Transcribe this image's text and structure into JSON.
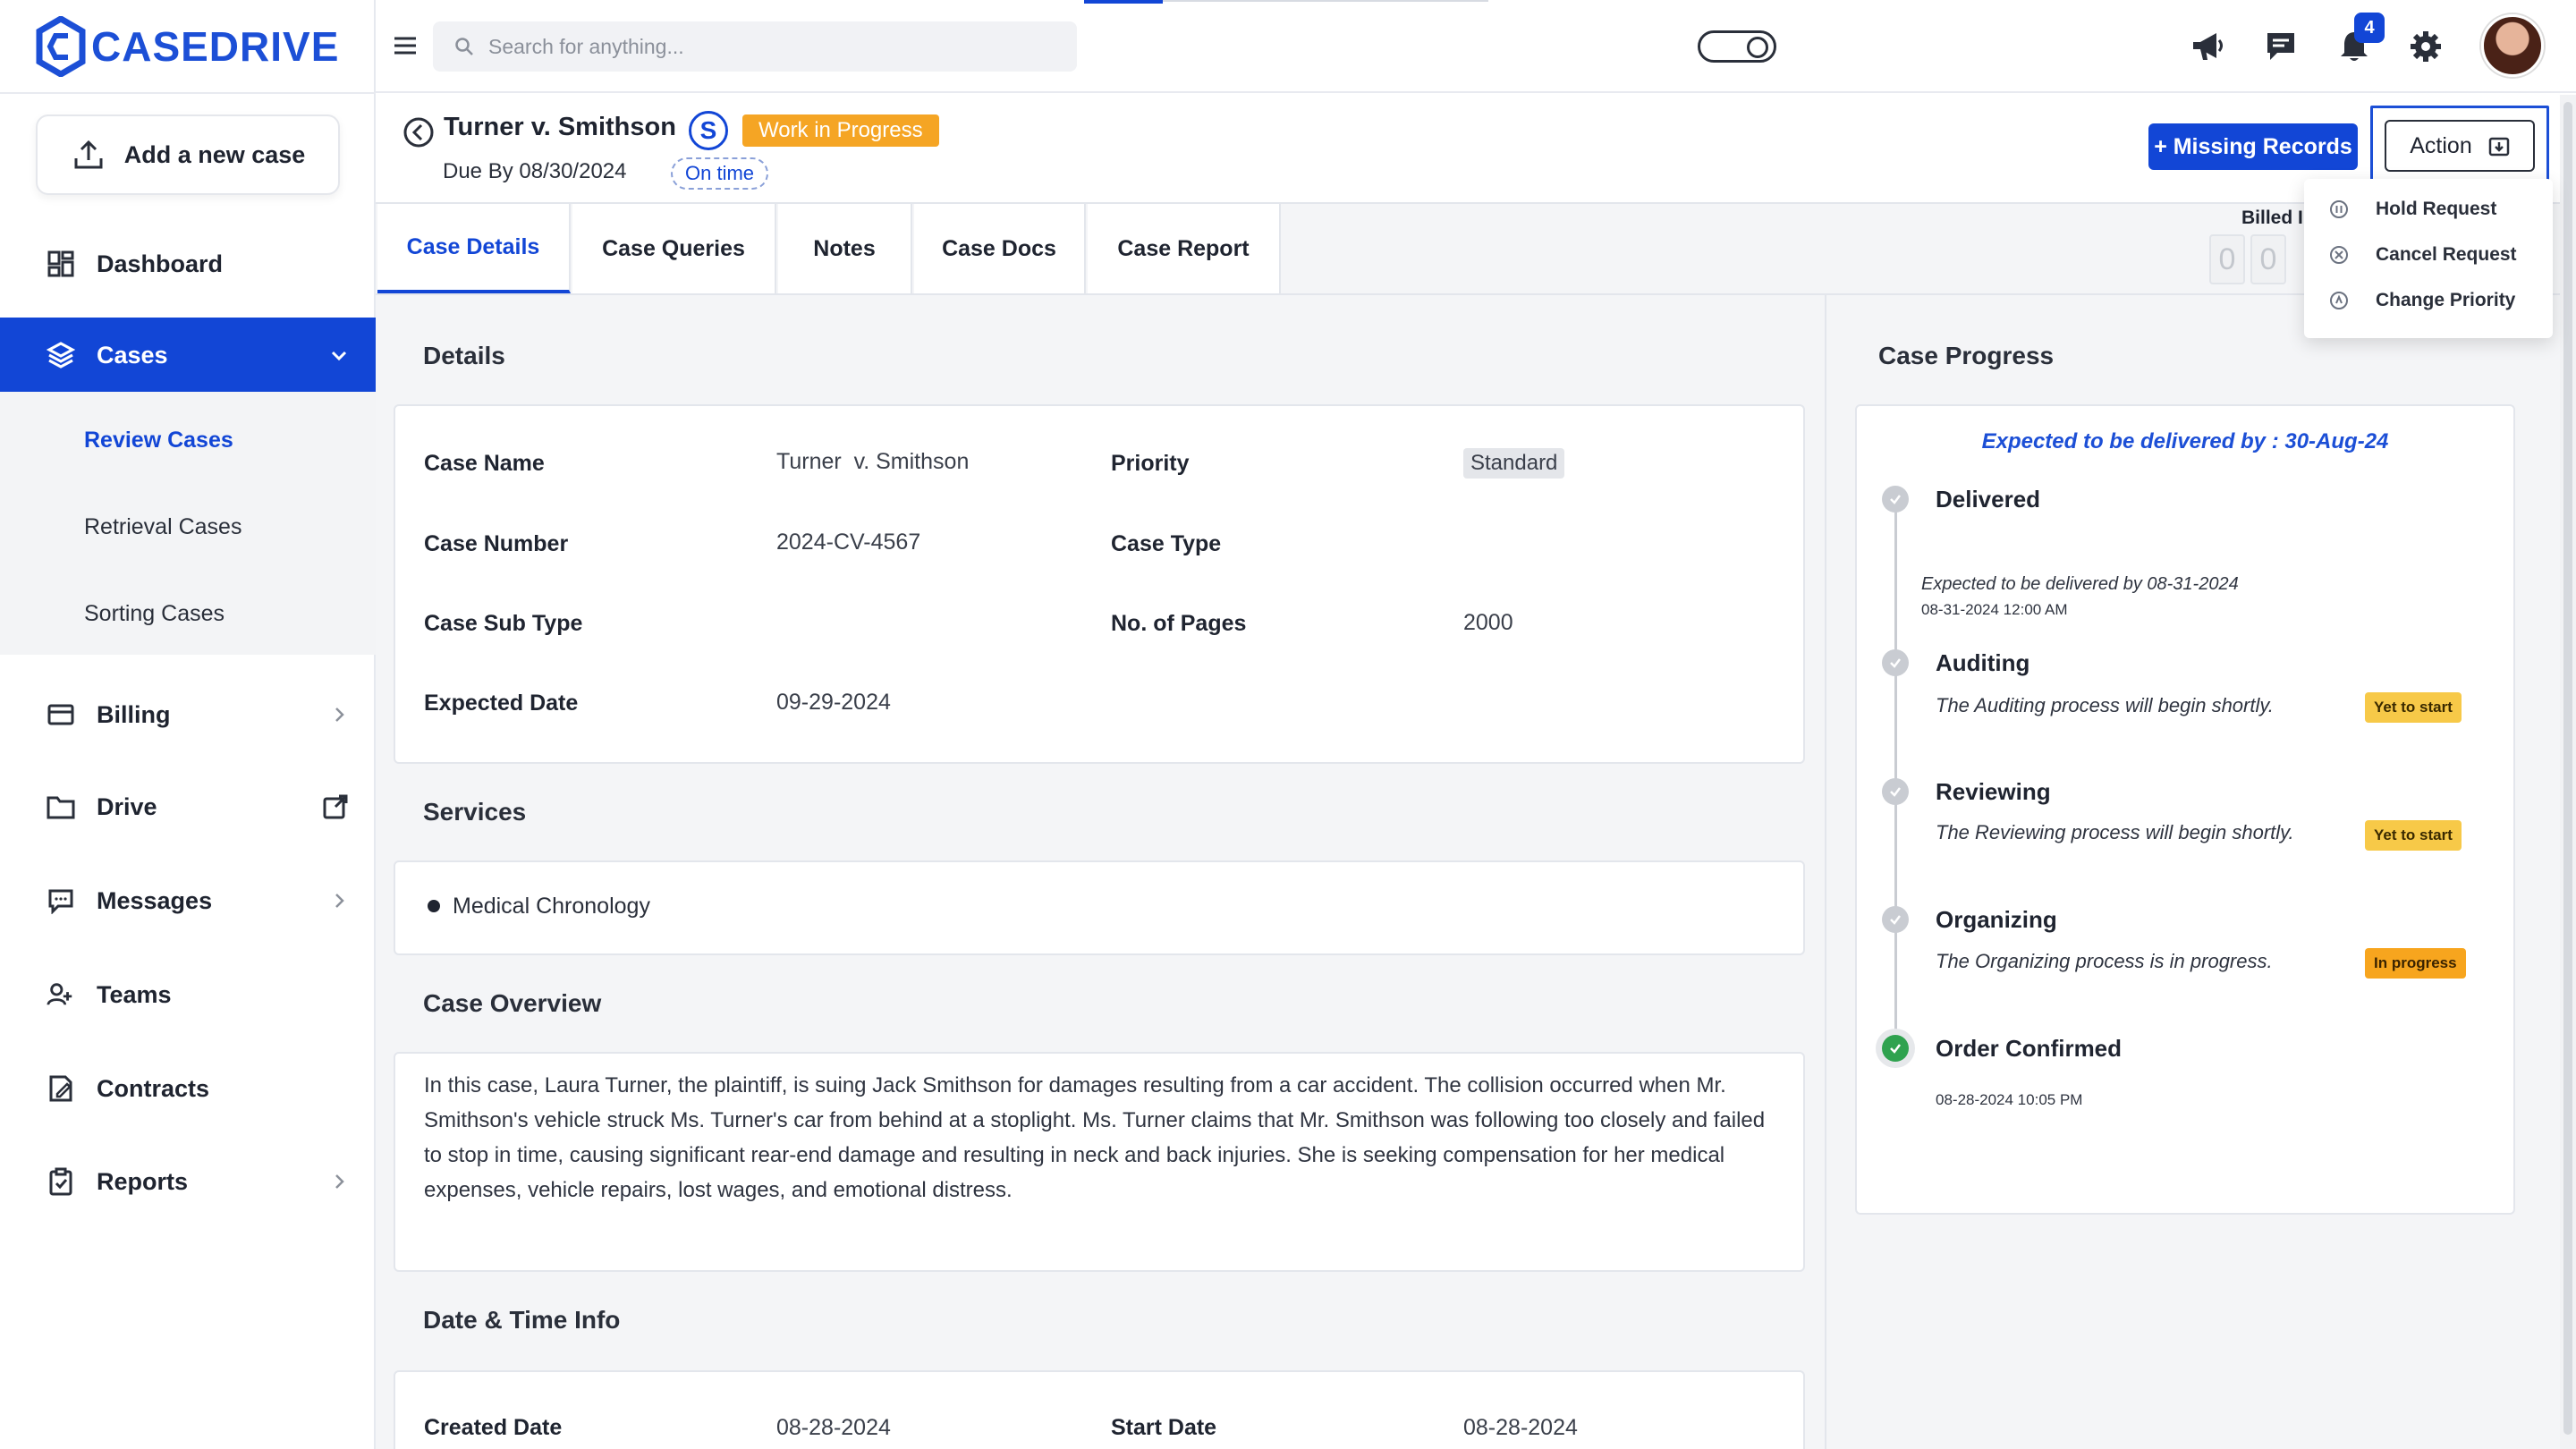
{
  "brand": {
    "name": "CASEDRIVE",
    "color": "#1c4fd6"
  },
  "sidebar": {
    "add_case_label": "Add a new case",
    "items": [
      {
        "label": "Dashboard",
        "icon": "dashboard-icon"
      },
      {
        "label": "Cases",
        "icon": "layers-icon",
        "active": true
      },
      {
        "label": "Billing",
        "icon": "card-icon"
      },
      {
        "label": "Drive",
        "icon": "folder-icon"
      },
      {
        "label": "Messages",
        "icon": "chat-icon"
      },
      {
        "label": "Teams",
        "icon": "users-icon"
      },
      {
        "label": "Contracts",
        "icon": "contract-icon"
      },
      {
        "label": "Reports",
        "icon": "clipboard-icon"
      }
    ],
    "case_subitems": [
      {
        "label": "Review Cases",
        "active": true
      },
      {
        "label": "Retrieval Cases"
      },
      {
        "label": "Sorting Cases"
      }
    ]
  },
  "topbar": {
    "search_placeholder": "Search for anything...",
    "notification_count": "4"
  },
  "case": {
    "title": "Turner v. Smithson",
    "s_badge": "S",
    "status": "Work in Progress",
    "due_by": "Due By 08/30/2024",
    "timeliness": "On time",
    "missing_records_label": "+ Missing Records",
    "action_label": "Action"
  },
  "action_menu": [
    {
      "label": "Hold Request",
      "icon": "pause-circle-icon"
    },
    {
      "label": "Cancel Request",
      "icon": "x-circle-icon"
    },
    {
      "label": "Change Priority",
      "icon": "priority-circle-icon"
    }
  ],
  "tabs": [
    "Case Details",
    "Case Queries",
    "Notes",
    "Case Docs",
    "Case Report"
  ],
  "billed": {
    "label": "Billed I",
    "digits": [
      "0",
      "0"
    ]
  },
  "details": {
    "title": "Details",
    "case_name_label": "Case Name",
    "case_name": "Turner  v. Smithson",
    "priority_label": "Priority",
    "priority": "Standard",
    "case_number_label": "Case Number",
    "case_number": "2024-CV-4567",
    "case_type_label": "Case Type",
    "case_sub_type_label": "Case Sub Type",
    "pages_label": "No. of Pages",
    "pages": "2000",
    "expected_date_label": "Expected Date",
    "expected_date": "09-29-2024"
  },
  "services": {
    "title": "Services",
    "items": [
      "Medical Chronology"
    ]
  },
  "overview": {
    "title": "Case Overview",
    "text": "In this case, Laura Turner, the plaintiff, is suing Jack Smithson for damages resulting from a car accident. The collision occurred when Mr. Smithson's vehicle struck Ms. Turner's car from behind at a stoplight. Ms. Turner claims that Mr. Smithson was following too closely and failed to stop in time, causing significant rear-end damage and resulting in neck and back injuries. She is seeking compensation for her medical expenses, vehicle repairs, lost wages, and emotional distress."
  },
  "datetime": {
    "title": "Date & Time Info",
    "created_label": "Created Date",
    "created": "08-28-2024",
    "start_label": "Start Date",
    "start": "08-28-2024"
  },
  "progress": {
    "title": "Case Progress",
    "expected": "Expected to be delivered by : 30-Aug-24",
    "steps": [
      {
        "title": "Delivered",
        "note": "Expected to be delivered by 08-31-2024",
        "time": "08-31-2024 12:00 AM"
      },
      {
        "title": "Auditing",
        "desc": "The Auditing process will begin shortly.",
        "status": "Yet to start"
      },
      {
        "title": "Reviewing",
        "desc": "The Reviewing process will begin shortly.",
        "status": "Yet to start"
      },
      {
        "title": "Organizing",
        "desc": "The Organizing process is in progress.",
        "status": "In progress"
      },
      {
        "title": "Order Confirmed",
        "time": "08-28-2024 10:05 PM"
      }
    ]
  }
}
